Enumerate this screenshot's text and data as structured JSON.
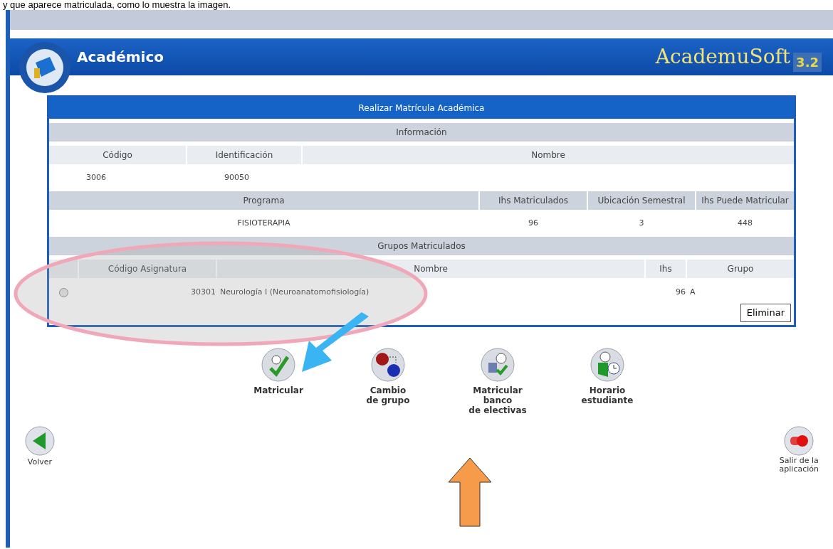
{
  "caption": "y que aparece matriculada, como lo muestra la imagen.",
  "header": {
    "title": "Académico",
    "brand": "AcademuSoft",
    "version": "3.2"
  },
  "panel": {
    "title": "Realizar Matrícula Académica",
    "info_title": "Información",
    "person_columns": [
      "Código",
      "Identificación",
      "Nombre"
    ],
    "person_row": [
      "3006",
      "90050"
    ],
    "program_columns": [
      "Programa",
      "Ihs Matriculados",
      "Ubicación Semestral",
      "Ihs Puede Matricular"
    ],
    "program_row": [
      "FISIOTERAPIA",
      "96",
      "3",
      "448"
    ],
    "groups_title": "Grupos Matriculados",
    "group_columns": [
      "Código Asignatura",
      "Nombre",
      "Ihs",
      "Grupo"
    ],
    "group_rows": [
      {
        "code": "30301",
        "name": "Neurología I (Neuroanatomofisiología)",
        "ihs": "96",
        "group": "A",
        "selected": false
      }
    ],
    "delete_button": "Eliminar"
  },
  "actions": [
    {
      "kind": "enroll",
      "label": "Matricular"
    },
    {
      "kind": "change",
      "label": "Cambio\nde grupo"
    },
    {
      "kind": "electives",
      "label": "Matricular\nbanco\nde electivas"
    },
    {
      "kind": "schedule",
      "label": "Horario\nestudiante"
    }
  ],
  "back": {
    "label": "Volver"
  },
  "exit": {
    "label": "Salir de la\naplicación"
  }
}
